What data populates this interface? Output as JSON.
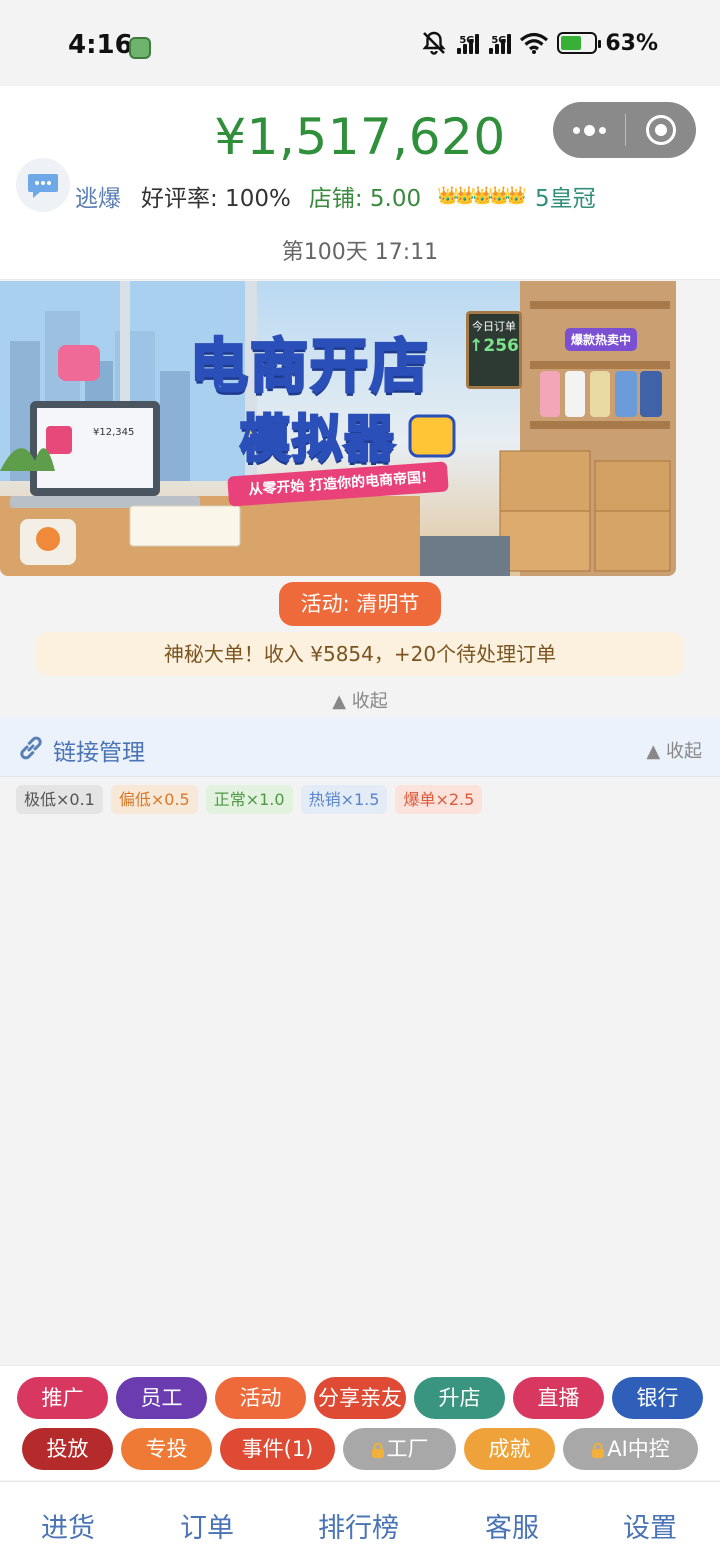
{
  "status_bar": {
    "time": "4:16",
    "network_1": "5G",
    "network_2": "5G",
    "battery_percent": "63%",
    "battery_level": 0.63
  },
  "header": {
    "money": "¥1,517,620",
    "player_name": "逃爆",
    "rating": "好评率: 100%",
    "store_score": "店铺: 5.00",
    "crowns": "👑👑👑👑👑",
    "level": "5皇冠",
    "day": "第100天 17:11"
  },
  "banner": {
    "title_line1": "电商开店",
    "title_line2": "模拟器",
    "subtitle": "从零开始 打造你的电商帝国!",
    "board_label": "今日订单",
    "board_value": "↑256",
    "hot_label": "爆款热卖中",
    "screen_value": "¥12,345"
  },
  "activity": {
    "label": "活动: 清明节"
  },
  "notice": {
    "text": "神秘大单！收入 ¥5854，+20个待处理订单"
  },
  "collapse_label": "▲ 收起",
  "link_panel": {
    "title": "链接管理",
    "collapse_label": "▲ 收起",
    "tags": [
      "极低×0.1",
      "偏低×0.5",
      "正常×1.0",
      "热销×1.5",
      "爆单×2.5"
    ]
  },
  "actions": {
    "row1": [
      "推广",
      "员工",
      "活动",
      "分享亲友",
      "升店",
      "直播",
      "银行"
    ],
    "row2": [
      "投放",
      "专投",
      "事件(1)",
      "工厂",
      "成就",
      "AI中控"
    ]
  },
  "colors": {
    "money": "#2f8f3a",
    "tab_text": "#4a74b5",
    "btn_promote": "#d8385f",
    "btn_staff": "#6b3bb0",
    "btn_activity": "#ef6a3a",
    "btn_share": "#de4a33",
    "btn_upgrade": "#3a9580",
    "btn_live": "#d8385f",
    "btn_bank": "#2f5fb8",
    "btn_ads": "#b52a2a",
    "btn_target": "#ef7a35",
    "btn_event": "#de4a33",
    "btn_locked": "#a8a8a8",
    "btn_achieve": "#f0a23a"
  },
  "tabbar": [
    "进货",
    "订单",
    "排行榜",
    "客服",
    "设置"
  ]
}
